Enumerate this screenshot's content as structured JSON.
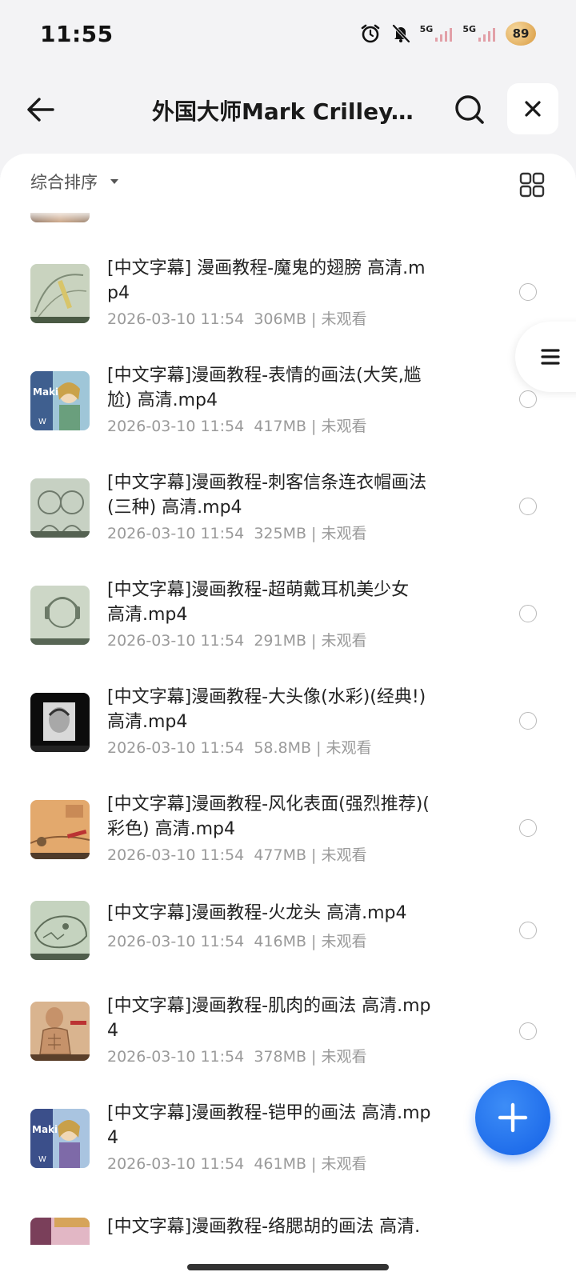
{
  "status": {
    "time": "11:55",
    "net1": "5G",
    "net2": "5G",
    "battery": "89"
  },
  "header": {
    "title": "外国大师Mark Crilley...",
    "icons": {
      "back": "arrow-left-icon",
      "search": "search-icon",
      "close": "close-icon"
    }
  },
  "sort": {
    "label": "综合排序",
    "view_icon": "grid-view-icon"
  },
  "files": [
    {
      "name": "[中文字幕] 漫画教程-魔鬼的翅膀 高清.mp4",
      "line1": "[中文字幕] 漫画教程-魔鬼的翅膀 高清.m",
      "line2": "p4",
      "date": "2026-03-10 11:54",
      "size": "306MB",
      "status": "未观看"
    },
    {
      "name": "[中文字幕]漫画教程-表情的画法(大笑,尴尬) 高清.mp4",
      "line1": "[中文字幕]漫画教程-表情的画法(大笑,尴",
      "line2": "尬) 高清.mp4",
      "date": "2026-03-10 11:54",
      "size": "417MB",
      "status": "未观看"
    },
    {
      "name": "[中文字幕]漫画教程-刺客信条连衣帽画法(三种) 高清.mp4",
      "line1": "[中文字幕]漫画教程-刺客信条连衣帽画法",
      "line2": "(三种) 高清.mp4",
      "date": "2026-03-10 11:54",
      "size": "325MB",
      "status": "未观看"
    },
    {
      "name": "[中文字幕]漫画教程-超萌戴耳机美少女 高清.mp4",
      "line1": "[中文字幕]漫画教程-超萌戴耳机美少女",
      "line2": "高清.mp4",
      "date": "2026-03-10 11:54",
      "size": "291MB",
      "status": "未观看"
    },
    {
      "name": "[中文字幕]漫画教程-大头像(水彩)(经典!) 高清.mp4",
      "line1": "[中文字幕]漫画教程-大头像(水彩)(经典!)",
      "line2": "高清.mp4",
      "date": "2026-03-10 11:54",
      "size": "58.8MB",
      "status": "未观看"
    },
    {
      "name": "[中文字幕]漫画教程-风化表面(强烈推荐)(彩色) 高清.mp4",
      "line1": "[中文字幕]漫画教程-风化表面(强烈推荐)(",
      "line2": "彩色) 高清.mp4",
      "date": "2026-03-10 11:54",
      "size": "477MB",
      "status": "未观看"
    },
    {
      "name": "[中文字幕]漫画教程-火龙头 高清.mp4",
      "line1": "[中文字幕]漫画教程-火龙头 高清.mp4",
      "line2": "",
      "date": "2026-03-10 11:54",
      "size": "416MB",
      "status": "未观看"
    },
    {
      "name": "[中文字幕]漫画教程-肌肉的画法 高清.mp4",
      "line1": "[中文字幕]漫画教程-肌肉的画法 高清.mp",
      "line2": "4",
      "date": "2026-03-10 11:54",
      "size": "378MB",
      "status": "未观看"
    },
    {
      "name": "[中文字幕]漫画教程-铠甲的画法 高清.mp4",
      "line1": "[中文字幕]漫画教程-铠甲的画法 高清.mp",
      "line2": "4",
      "date": "2026-03-10 11:54",
      "size": "461MB",
      "status": "未观看"
    },
    {
      "name": "[中文字幕]漫画教程-络腮胡的画法 高清.",
      "line1": "[中文字幕]漫画教程-络腮胡的画法 高清.",
      "line2": "",
      "date": "",
      "size": "",
      "status": ""
    }
  ],
  "side_tab": {
    "icon": "menu-icon"
  },
  "fab": {
    "icon": "plus-icon"
  },
  "colors": {
    "accent": "#1a6cf0",
    "meta": "#9a9a9a",
    "background": "#f3f3f5"
  }
}
